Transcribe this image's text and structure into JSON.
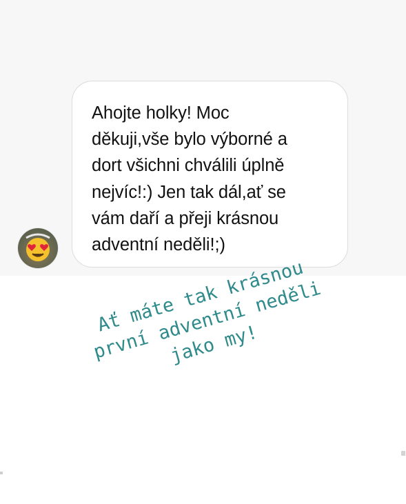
{
  "message": {
    "text": "Ahojte holky! Moc\nděkuji,vše bylo výborné a\ndort všichni chválili úplně\nnejvíc!:) Jen tak dál,ať se\nvám daří a přeji krásnou\nadventní neděli!;)",
    "avatar_icon": "heart-eyes-emoji-icon"
  },
  "overlay_text": {
    "line1": "Ať máte tak krásnou",
    "line2": "první adventní neděli",
    "line3": "jako my!",
    "color": "#2f8a8b"
  }
}
